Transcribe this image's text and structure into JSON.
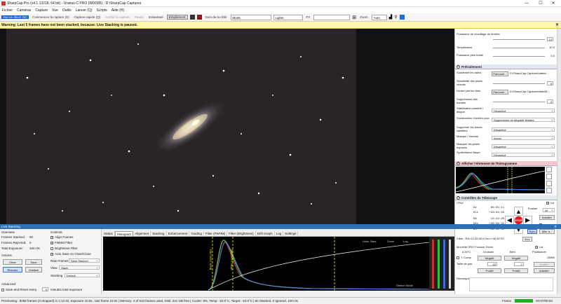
{
  "titlebar": {
    "title": "SharpCap Pro (v4.1.13218, 64 bit) - Uranus-C PRO (IMX585) - D:\\SharpCap Captures",
    "minimize": "—",
    "maximize": "☐",
    "close": "✕"
  },
  "menu": [
    "Fichier",
    "Caméras",
    "Capture",
    "Vue",
    "Outils",
    "Lancer (Q)",
    "Scripts",
    "Aide (H)"
  ],
  "toolbar": {
    "live_view": "Vue en direct (W)",
    "start_capture": "Commencer la capture (S)",
    "quick_capture": "Capture rapide (Q)",
    "stop_capture": "Arrêter la capture",
    "pause": "Pause",
    "snapshot": "Instantané",
    "stacking": "Empilement",
    "target_label": "Nom de la cible",
    "target_value": "M106",
    "lights": "Lights",
    "fx": "FX",
    "zoom_label": "Zoom",
    "zoom_value": "Auto"
  },
  "warning": {
    "text": "Warning: Last 5 frames have not been stacked, because: Live Stacking is paused.",
    "close": "✕"
  },
  "right_panel": {
    "top_rows": [
      {
        "label": "Puissance de chauffage de fenêtre",
        "value": "10"
      },
      {
        "label": "Température",
        "value": "10.0"
      },
      {
        "label": "Puissance plus froide",
        "value": "0.0"
      }
    ],
    "preprocessing": {
      "title": "Prétraitement",
      "dark_label": "Soustraire les darks",
      "dark_btn": "Parcourir...",
      "dark_path": "D:\\SharpCap Captures\\darks\\...",
      "hot_label": "Sensibilité des pixels chauds",
      "hot_value": "5",
      "flat_label": "Diviser par les flats",
      "flat_btn": "Parcourir...",
      "flat_path": "D:\\SharpCap Captures\\flats\\M...",
      "bands_label": "Suppression des bandes",
      "bands_value": "0",
      "stab_label": "Stabilisation planète / disque",
      "stab_value": "Désactivé",
      "bg_label": "Soustraction d'arrière-plan",
      "bg_value": "Suppression du dégradé linéaire",
      "sat_label": "Supprimer les traces satellites",
      "sat_value": "Désactivé",
      "mask_label": "Masque / bordure",
      "mask_value": "Aucun",
      "exposed_label": "Masquer les pixels exposés",
      "exposed_value": "Désactivé",
      "synth_label": "Synthétiseur Bayer",
      "synth_value": "Désactivé"
    },
    "histogram": {
      "title": "Afficher l'étirement de l'histogramme"
    },
    "telescope": {
      "title": "Contrôles du Télescope",
      "device": "CPwI",
      "link": "Lié",
      "az_label": "Az",
      "az": "66:55:11",
      "alt_label": "Alt",
      "alt": "+43:04:33",
      "ra_label": "RA",
      "ra": "12:22:20",
      "dec_label": "Déc",
      "dec": "+46:59:35",
      "ah_label": "AH",
      "ah": "-02:32:52",
      "rate_label": "Évaluer",
      "rate": "4x",
      "install": "Installer",
      "park": "se garer",
      "stop": "STOP",
      "goto": "Aller à...",
      "sync": "Sync",
      "target_line": "Cible : RA=12:22:40.0,Dec=+46:57:53",
      "env": "Env"
    },
    "focuser": {
      "title": "Moonlite DRO Focuser Driver",
      "link": "Lié",
      "temp": "0.00°C",
      "coarse": "Grossier",
      "fine": "Bien",
      "positioner": "Positionner",
      "tcomp": "T. Comp",
      "neg": "Négatif",
      "neg2": "Négatif",
      "pos_value": "15890",
      "step_label": "Taille de pas",
      "step_coarse": "40",
      "step_fine": "1",
      "stop": "Arrêter",
      "pos1": "Positif",
      "pos2": "Positif",
      "install": "Installer",
      "notes": "Remarques"
    }
  },
  "live_stacking": {
    "title": "Live Stacking",
    "overview": "Overview",
    "stacked_label": "Frames Stacked:",
    "stacked": "60",
    "rejected_label": "Frames Rejected:",
    "rejected": "0",
    "total_label": "Total Exposure:",
    "total": "10m 0s",
    "actions": "Actions",
    "clear": "Clear",
    "save": "Save",
    "pause": "Pause",
    "resume": "Resume",
    "unstack": "Unstack",
    "advanced": "Advanced",
    "save_reset": "Save and Reset every",
    "minutes": "5",
    "minutes_label": "minutes total exposure",
    "controls": "Controls",
    "align": "Align Frames",
    "fwhm": "FWHM Filter",
    "brightness": "Brightness Filter",
    "autosave": "Auto Save on Clear/Close",
    "raw_label": "Raw Frames",
    "raw_value": "Save Stacked",
    "view_label": "View",
    "view_value": "Stack",
    "stacking_label": "Stacking",
    "stacking_value": "Default",
    "tabs": [
      "Status",
      "Histogram",
      "Alignment",
      "Stacking",
      "Enhancement",
      "Guiding",
      "Filter (FWHM)",
      "Filter (Brightness)",
      "Drift Graph",
      "Log",
      "Settings"
    ],
    "hist_opts": "Histo. Bars",
    "zoom_label": "Zoom",
    "log_label": "Log",
    "stretch_label": "Stretch Mode",
    "black_label": "Black Level (SE)",
    "white_label": "White Level (SE)"
  },
  "status": {
    "text": "Previewing : 8268 frames (0 dropped) in 1:12:42, exposure 10.0s , last frame 10.0s | Memory: 4 of 510 frames used, Disk: 241 GB free | Cooler: 9%, Temp: -10.0°C, Target: -10.0°C | 60 Stacked, 0 Ignored, 10m 0s",
    "frame_label": "Frame",
    "frame_count": "00:07/00:03"
  },
  "colors": {
    "accent": "#0b63c8",
    "warning": "#fff6a8",
    "stack_title": "#2e6fb7",
    "hist_header": "#f6c7cc"
  }
}
